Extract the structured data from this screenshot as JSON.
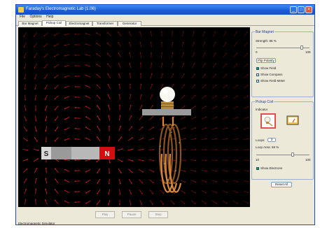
{
  "window": {
    "title": "Faraday's Electromagnetic Lab (1.06)",
    "status": "Electromagnetic Simulator"
  },
  "menu": [
    "File",
    "Options",
    "Help"
  ],
  "tabs": [
    {
      "label": "Bar Magnet",
      "active": false
    },
    {
      "label": "Pickup Coil",
      "active": true
    },
    {
      "label": "Electromagnet",
      "active": false
    },
    {
      "label": "Transformer",
      "active": false
    },
    {
      "label": "Generator",
      "active": false
    }
  ],
  "bar_magnet": {
    "north_label": "N",
    "south_label": "S",
    "north_color": "#d01010",
    "south_color": "#9a9a9a"
  },
  "colors": {
    "field_red": "#cc1d1d",
    "coil": "#c87b2a",
    "bulb": "#f8f8f0",
    "window_blue": "#1b5ad6",
    "panel_bg": "#ece9d8"
  },
  "bottom_buttons": [
    "Play",
    "Pause",
    "Step"
  ],
  "panel": {
    "bar_magnet": {
      "title": "Bar Magnet",
      "strength_label": "Strength: 86 %",
      "strength_fraction": 0.86,
      "range_min": "0",
      "range_max": "100",
      "flip_button": "Flip Polarity",
      "checkboxes": [
        {
          "label": "Show Field",
          "checked": true
        },
        {
          "label": "Show Compass",
          "checked": false
        },
        {
          "label": "Show Field Meter",
          "checked": false
        }
      ]
    },
    "pickup_coil": {
      "title": "Pickup Coil",
      "indicator_label": "Indicator",
      "indicators": [
        {
          "name": "lightbulb-icon",
          "selected": true
        },
        {
          "name": "voltmeter-icon",
          "selected": false
        }
      ],
      "loops_label": "Loops:",
      "loops_value": "3",
      "area_label": "Loop Area: 68 %",
      "area_fraction": 0.68,
      "range_min": "10",
      "range_max": "100",
      "electrons_label": "Show Electrons",
      "electrons_checked": true
    },
    "reset_button": "Reset All"
  }
}
